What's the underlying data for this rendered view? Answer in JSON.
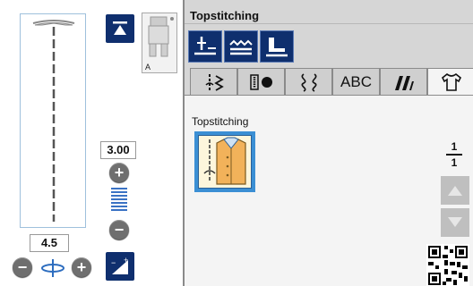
{
  "left_panel": {
    "foot_letter": "A",
    "width_value": "3.00",
    "length_value": "4.5",
    "plus_glyph": "+",
    "minus_glyph": "−"
  },
  "right_panel": {
    "title": "Topstitching",
    "tabs": [
      {
        "name": "utility-stitches",
        "label": ""
      },
      {
        "name": "buttonhole",
        "label": ""
      },
      {
        "name": "decorative",
        "label": ""
      },
      {
        "name": "character",
        "label": "ABC"
      },
      {
        "name": "quilting",
        "label": ""
      },
      {
        "name": "garment",
        "label": "",
        "active": true
      }
    ],
    "category_label": "Topstitching",
    "page_current": "1",
    "page_total": "1"
  },
  "colors": {
    "navy": "#0f2f6e",
    "tile_blue": "#3b8fd4",
    "panel_gray": "#d6d6d6",
    "stitch_orange": "#f2b25a"
  }
}
